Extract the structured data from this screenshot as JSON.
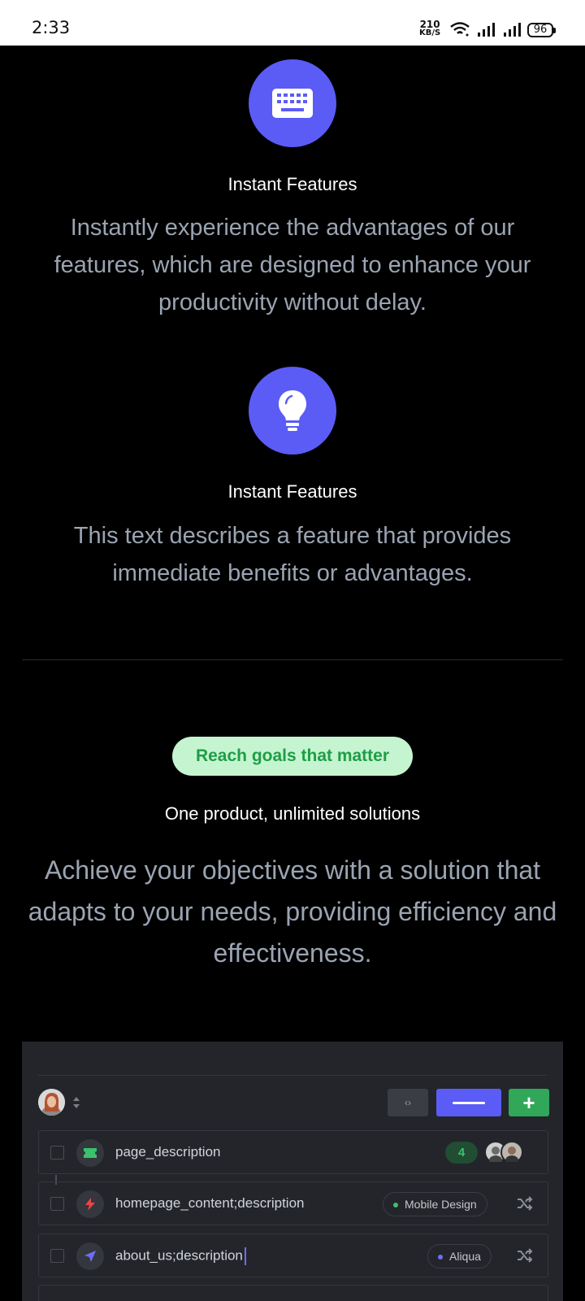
{
  "status_bar": {
    "time": "2:33",
    "net_speed_value": "210",
    "net_speed_unit": "KB/S",
    "battery": "96"
  },
  "features": [
    {
      "icon": "keyboard-icon",
      "title": "Instant Features",
      "description": "Instantly experience the advantages of our features, which are designed to enhance your productivity without delay."
    },
    {
      "icon": "lightbulb-icon",
      "title": "Instant Features",
      "description": "This text describes a feature that provides immediate benefits or advantages."
    }
  ],
  "goals": {
    "badge": "Reach goals that matter",
    "title": "One product, unlimited solutions",
    "description": "Achieve your objectives with a solution that adapts to your needs, providing efficiency and effectiveness."
  },
  "dashboard": {
    "code_button": "‹›",
    "add_button": "+",
    "rows": [
      {
        "label": "page_description",
        "icon": "ticket-icon",
        "icon_color": "#3bc16d",
        "count": "4"
      },
      {
        "label": "homepage_content;description",
        "icon": "bolt-icon",
        "icon_color": "#ef4444",
        "tag": "Mobile Design",
        "tag_color": "#3bc16d"
      },
      {
        "label": "about_us;description",
        "icon": "navigation-icon",
        "icon_color": "#6e6ff7",
        "tag": "Aliqua",
        "tag_color": "#6e6ff7"
      }
    ]
  },
  "colors": {
    "accent": "#5b5cf6",
    "badge_bg": "#c5f5d0",
    "badge_text": "#1f9d47",
    "muted_text": "#9aa4b2"
  }
}
